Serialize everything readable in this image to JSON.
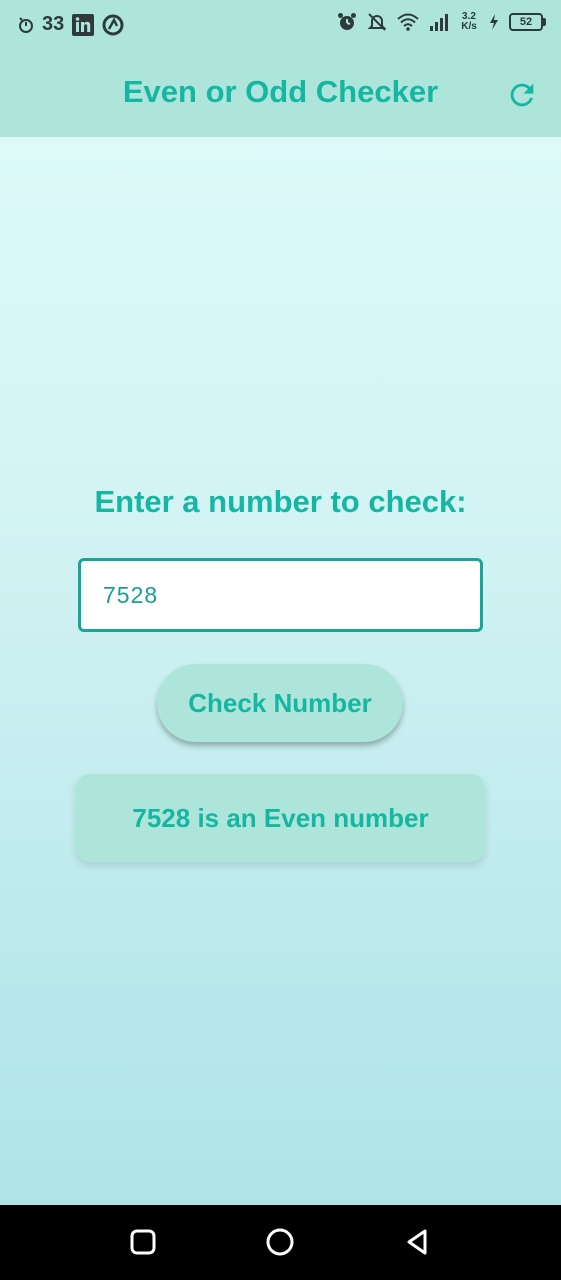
{
  "status_bar": {
    "time": "33",
    "network_speed_value": "3.2",
    "network_speed_unit": "K/s",
    "battery_level": "52",
    "icons": [
      "alarm-icon",
      "linkedin-icon",
      "app-icon",
      "alarm-clock-icon",
      "notifications-off-icon",
      "wifi-icon",
      "signal-icon",
      "charging-icon",
      "battery-icon"
    ]
  },
  "app_bar": {
    "title": "Even or Odd Checker",
    "refresh_icon": "refresh-icon"
  },
  "main": {
    "prompt": "Enter a number to check:",
    "input_value": "7528",
    "check_button_label": "Check Number",
    "result": "7528 is an Even number"
  },
  "nav_bar": {
    "icons": [
      "recents-icon",
      "home-icon",
      "back-icon"
    ]
  },
  "colors": {
    "accent": "#15b7a2",
    "app_bar_bg": "#aee5db",
    "input_border": "#16a896",
    "nav_bar_bg": "#000000"
  }
}
